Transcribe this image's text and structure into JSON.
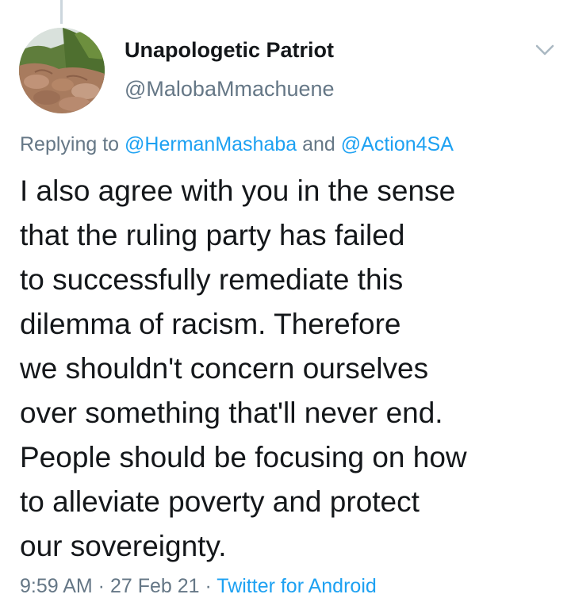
{
  "tweet": {
    "author": {
      "display_name": "Unapologetic Patriot",
      "handle": "@MalobaMmachuene",
      "avatar_icon": "landscape-rocks-avatar"
    },
    "menu_icon": "chevron-down-icon",
    "replying_prefix": "Replying to",
    "replying_mention_1": "@HermanMashaba",
    "replying_and": "and",
    "replying_mention_2": "@Action4SA",
    "text_lines": [
      "I also agree with you in the sense",
      "that the ruling party has failed",
      "to successfully remediate this",
      "dilemma of racism. Therefore",
      "we shouldn't concern ourselves",
      "over something that'll never end.",
      "People should be focusing on how",
      "to alleviate poverty and protect",
      "our sovereignty."
    ],
    "meta_time": "9:59 AM · 27 Feb 21 ·",
    "meta_source": "Twitter for Android"
  },
  "colors": {
    "text": "#14171a",
    "secondary": "#657786",
    "link": "#1da1f2",
    "thread_line": "#ccd6dd"
  }
}
